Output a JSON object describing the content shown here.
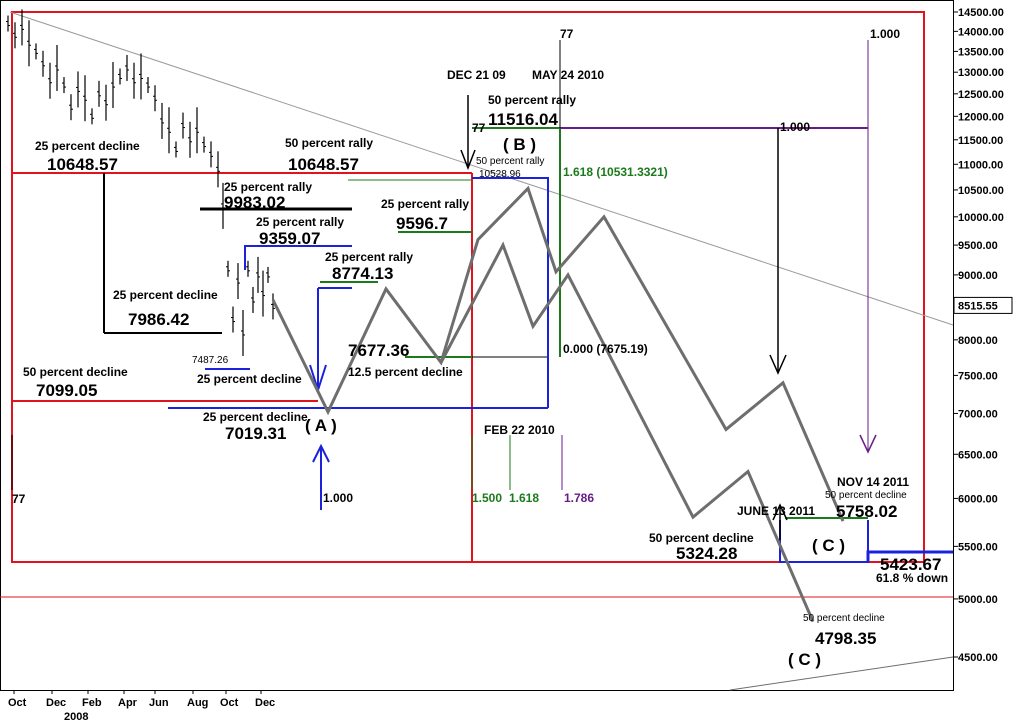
{
  "chart_data": {
    "type": "line",
    "title": "",
    "xlabel": "",
    "ylabel": "",
    "scale": "log",
    "ylim": [
      4250,
      14600
    ],
    "y_ticks": [
      "14500.00",
      "14000.00",
      "13500.00",
      "13000.00",
      "12500.00",
      "12000.00",
      "11500.00",
      "11000.00",
      "10500.00",
      "10000.00",
      "9500.00",
      "9000.00",
      "8500.00",
      "8000.00",
      "7500.00",
      "7000.00",
      "6500.00",
      "6000.00",
      "5500.00",
      "5000.00",
      "4500.00"
    ],
    "last_price": "8515.55",
    "x_ticks": [
      "Oct",
      "Dec",
      "Feb",
      "Apr",
      "Jun",
      "Aug",
      "Oct",
      "Dec"
    ],
    "x_year": "2008",
    "series": [
      {
        "values": [
          [
            0,
            14200
          ],
          [
            7,
            13900
          ],
          [
            14,
            14100
          ],
          [
            21,
            13700
          ],
          [
            28,
            13500
          ],
          [
            35,
            13200
          ],
          [
            42,
            12800
          ],
          [
            49,
            13100
          ],
          [
            56,
            12700
          ],
          [
            63,
            12200
          ],
          [
            70,
            12600
          ],
          [
            77,
            12400
          ],
          [
            84,
            12000
          ],
          [
            91,
            12500
          ],
          [
            98,
            12300
          ],
          [
            105,
            12700
          ],
          [
            112,
            12900
          ],
          [
            119,
            13100
          ],
          [
            126,
            12800
          ],
          [
            133,
            12900
          ],
          [
            140,
            12700
          ],
          [
            147,
            12400
          ],
          [
            154,
            11900
          ],
          [
            161,
            11700
          ],
          [
            168,
            11300
          ],
          [
            175,
            11800
          ],
          [
            182,
            11500
          ],
          [
            189,
            11700
          ],
          [
            196,
            11400
          ],
          [
            203,
            11200
          ],
          [
            210,
            10900
          ],
          [
            215,
            10200
          ],
          [
            220,
            9100
          ],
          [
            225,
            8300
          ],
          [
            230,
            8900
          ],
          [
            235,
            8100
          ],
          [
            240,
            9100
          ],
          [
            245,
            8600
          ],
          [
            250,
            9000
          ],
          [
            255,
            8700
          ],
          [
            260,
            9000
          ],
          [
            265,
            8500
          ]
        ]
      },
      {
        "values": [
          [
            265,
            8600
          ],
          [
            320,
            7019.31
          ],
          [
            378,
            8774.13
          ],
          [
            433,
            7677.36
          ],
          [
            470,
            9596.7
          ],
          [
            520,
            10528.96
          ],
          [
            548,
            9050
          ],
          [
            596,
            10000
          ],
          [
            718,
            6800
          ],
          [
            775,
            7400
          ],
          [
            835,
            5758.02
          ]
        ]
      },
      {
        "values": [
          [
            433,
            7677.36
          ],
          [
            495,
            9500
          ],
          [
            525,
            8200
          ],
          [
            560,
            9000
          ],
          [
            685,
            5800
          ],
          [
            740,
            6300
          ],
          [
            805,
            4798.35
          ]
        ]
      }
    ],
    "annotations": {
      "left": [
        {
          "text": "25 percent decline",
          "value": "10648.57"
        },
        {
          "text": "25 percent decline",
          "value": "7986.42"
        },
        {
          "text": "25 percent decline",
          "value": "7487.26"
        },
        {
          "text": "50 percent decline",
          "value": "7099.05"
        },
        {
          "text": "25 percent decline",
          "value": "7019.31"
        }
      ],
      "rallies": [
        {
          "text": "50 percent rally",
          "value": "10648.57"
        },
        {
          "text": "25 percent rally",
          "value": "9983.02"
        },
        {
          "text": "25 percent rally",
          "value": "9359.07"
        },
        {
          "text": "25 percent rally",
          "value": "8774.13"
        },
        {
          "text": "25 percent rally",
          "value": "9596.7"
        },
        {
          "text": "50 percent rally",
          "value": "11516.04"
        },
        {
          "text": "50 percent rally",
          "value": "10528.96"
        }
      ],
      "low_7677": "7677.36",
      "decline_12_5": "12.5 percent decline",
      "wave_a": "( A )",
      "wave_b": "( B )",
      "wave_c": "( C )",
      "fib_one": "1.000",
      "fib_zero": "0.000 (7675.19)",
      "fib_1618": "1.618 (10531.3321)",
      "fib_150": "1.500",
      "fib_1618b": "1.618",
      "fib_1786": "1.786",
      "seventy_seven": "77",
      "dec21": "DEC 21 09",
      "may24": "MAY 24 2010",
      "feb22": "FEB 22 2010",
      "june13": "JUNE 13 2011",
      "nov14": "NOV 14 2011",
      "decline_50": "50 percent decline",
      "v5758": "5758.02",
      "v5324": "5324.28",
      "v4798": "4798.35",
      "v5423": "5423.67",
      "down618": "61.8 % down"
    },
    "colors": {
      "price": "#000000",
      "projection": "#6e6e6e",
      "red": "#e0141e",
      "blue": "#1a22dc",
      "green": "#1b7a1b",
      "purple": "#6a1b8a",
      "trend": "#9a9a9a"
    }
  }
}
